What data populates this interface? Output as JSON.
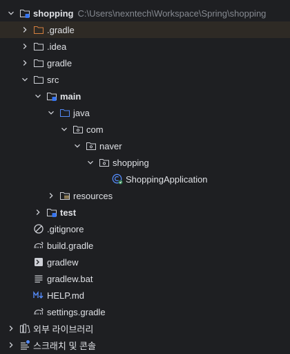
{
  "tree": {
    "root": {
      "label": "shopping",
      "path": "C:\\Users\\nexntech\\Workspace\\Spring\\shopping"
    },
    "gradle_dot": "gradle",
    "gradle_dot_prefix": ".",
    "idea": ".idea",
    "gradle": "gradle",
    "src": "src",
    "main": "main",
    "java": "java",
    "com": "com",
    "naver": "naver",
    "shopping_pkg": "shopping",
    "app_class": "ShoppingApplication",
    "resources": "resources",
    "test": "test",
    "gitignore": ".gitignore",
    "build_gradle": "build.gradle",
    "gradlew": "gradlew",
    "gradlew_bat": "gradlew.bat",
    "help_md": "HELP.md",
    "settings_gradle": "settings.gradle",
    "external_libs": "외부 라이브러리",
    "scratches": "스크래치 및 콘솔"
  },
  "colors": {
    "background": "#1e1f22",
    "selected_row": "#2e2a25",
    "text": "#dfe1e5",
    "path_text": "#868a91",
    "excluded_folder": "#d5803f",
    "source_folder": "#548af7",
    "module_badge": "#3574f0"
  },
  "icons": [
    "chevron-down",
    "chevron-right",
    "module-folder",
    "folder",
    "package",
    "class",
    "gradle",
    "terminal",
    "text-file",
    "markdown",
    "library",
    "scratch"
  ]
}
